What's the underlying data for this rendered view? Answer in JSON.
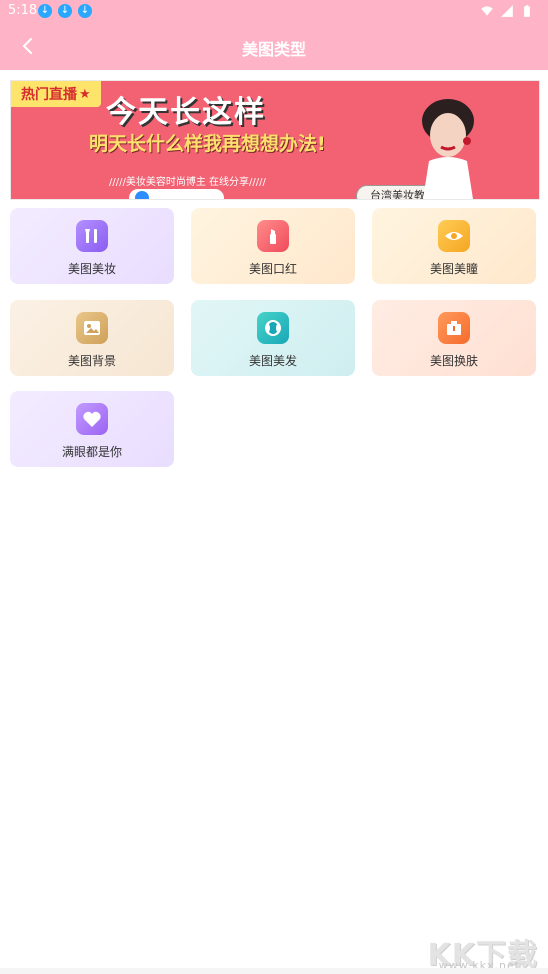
{
  "status_bar": {
    "time": "5:18",
    "notification_icons": [
      "download-icon",
      "download-icon",
      "download-icon"
    ],
    "system_icons": [
      "wifi-icon",
      "signal-icon",
      "battery-icon"
    ],
    "bg": "#ffb3c6"
  },
  "app_bar": {
    "title": "美图类型",
    "back_icon": "chevron-left-icon"
  },
  "banner": {
    "badge": "热门直播",
    "headline": "今天长这样",
    "subheadline": "明天长什么样我再想想办法!",
    "tagline": "/////美妆美容时尚博主 在线分享/////",
    "pill": "台湾美妆教父",
    "bg": "#f26273"
  },
  "categories": [
    {
      "label": "美图美妆",
      "icon": "makeup-brush-icon"
    },
    {
      "label": "美图口红",
      "icon": "lipstick-icon"
    },
    {
      "label": "美图美瞳",
      "icon": "eye-icon"
    },
    {
      "label": "美图背景",
      "icon": "image-icon"
    },
    {
      "label": "美图美发",
      "icon": "hair-icon"
    },
    {
      "label": "美图换肤",
      "icon": "wardrobe-icon"
    },
    {
      "label": "满眼都是你",
      "icon": "heart-icon"
    }
  ],
  "watermark": {
    "big": "KK下载",
    "small": "www.kkx.net"
  }
}
